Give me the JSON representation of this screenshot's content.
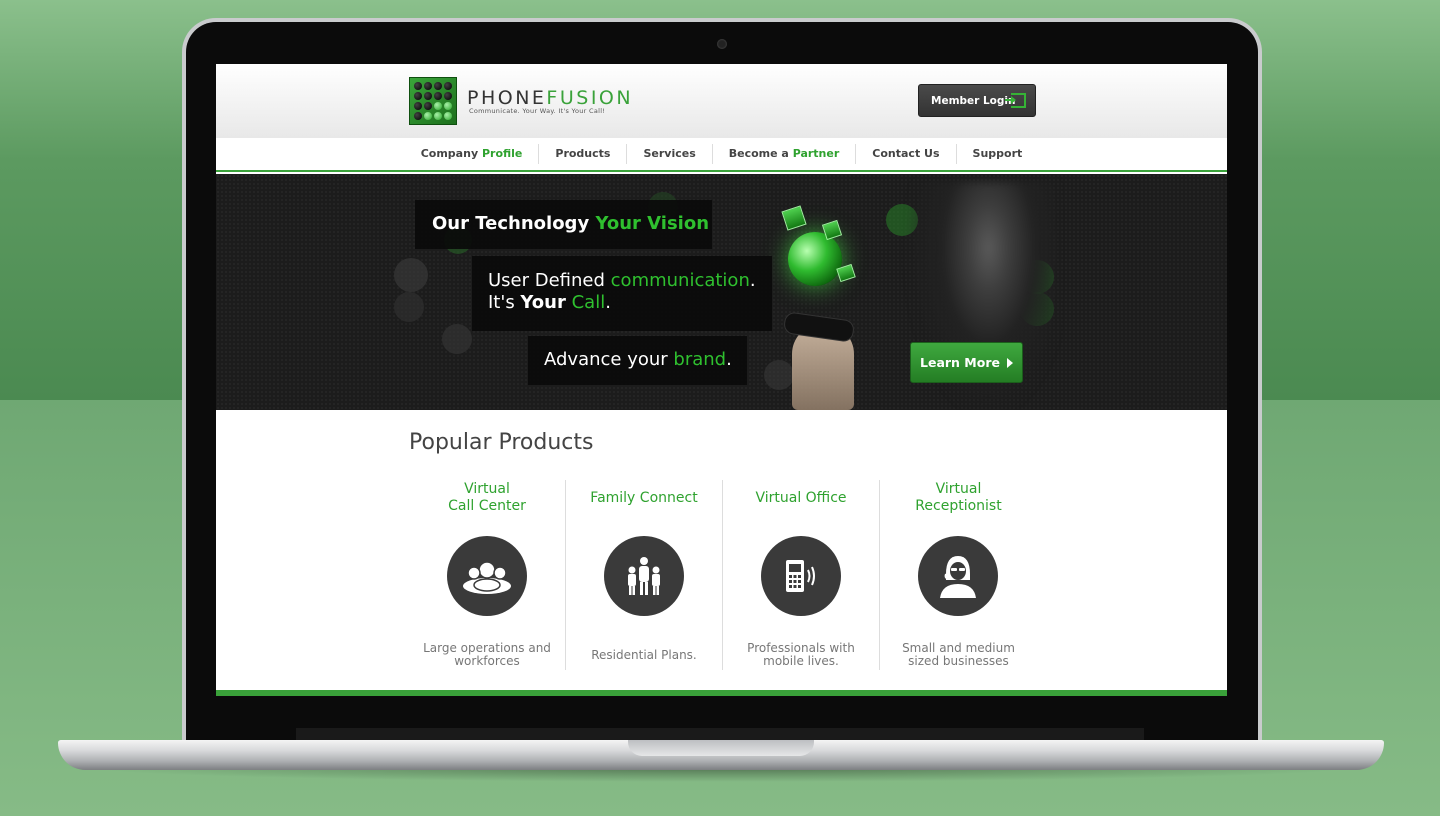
{
  "brand": {
    "name_main": "PHONE",
    "name_accent": "FUSION",
    "tagline": "Communicate.  Your Way.  It's Your Call!"
  },
  "header": {
    "login_label": "Member Login",
    "login_icon": "login-arrow-icon"
  },
  "nav": {
    "items": [
      {
        "text": "Company ",
        "accent": "Profile"
      },
      {
        "text": "Products",
        "accent": ""
      },
      {
        "text": "Services",
        "accent": ""
      },
      {
        "text": "Become a ",
        "accent": "Partner"
      },
      {
        "text": "Contact Us",
        "accent": ""
      },
      {
        "text": "Support",
        "accent": ""
      }
    ]
  },
  "hero": {
    "line1_white": "Our Technology ",
    "line1_green": "Your Vision",
    "line2a_white": "User Defined ",
    "line2a_green": "communication",
    "line2a_end": ".",
    "line2b_start": "It's ",
    "line2b_bold": "Your",
    "line2b_green": " Call",
    "line2b_end": ".",
    "line3_white": "Advance your ",
    "line3_green": "brand",
    "line3_end": ".",
    "cta_label": "Learn More"
  },
  "products": {
    "title": "Popular Products",
    "items": [
      {
        "name_l1": "Virtual",
        "name_l2": "Call Center",
        "desc_l1": "Large operations and",
        "desc_l2": "workforces",
        "icon": "group-icon"
      },
      {
        "name_l1": "Family Connect",
        "name_l2": "",
        "desc_l1": "Residential Plans.",
        "desc_l2": "",
        "icon": "family-icon"
      },
      {
        "name_l1": "Virtual Office",
        "name_l2": "",
        "desc_l1": "Professionals with",
        "desc_l2": "mobile lives.",
        "icon": "mobile-phone-icon"
      },
      {
        "name_l1": "Virtual",
        "name_l2": "Receptionist",
        "desc_l1": "Small and medium",
        "desc_l2": "sized businesses",
        "icon": "receptionist-icon"
      }
    ]
  },
  "colors": {
    "accent": "#3aa23a",
    "dark": "#3a3a3a",
    "background": "#5c9a60"
  }
}
